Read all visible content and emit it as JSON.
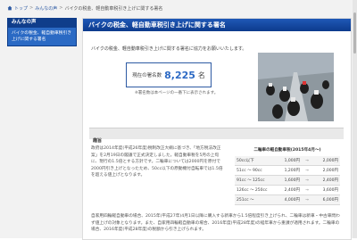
{
  "breadcrumb": {
    "items": [
      "トップ",
      "みんなの声",
      "バイクの税金、軽自動車税引き上げに関する署名"
    ]
  },
  "sidebar": {
    "heading": "みんなの声",
    "item": "バイクの税金、軽自動車税引き上げに関する署名"
  },
  "main": {
    "title": "バイクの税金、軽自動車税引き上げに関する署名",
    "lead": "バイクの税金、軽自動車税引き上げに関する署名に協力をお願いいたします。",
    "count": {
      "label": "現在の署名数",
      "value": "8,225",
      "unit": "名"
    },
    "count_note": "※署名数は本ページの一番下に表示されます。",
    "section_title": "趣旨",
    "para1": "政府は2014年度(平成26年度)税制改正大綱に基づき、「地方税法改正案」を2月19日の閣議で正式決定しました。軽自動車税を5月の上旬に、現行の1.5倍とする方針です。二輪車については2000円を原付で2000円引き上げとなったため、50cc以下の原動機付自転車では1.5倍を超える値上げとなります。",
    "para2": "自家用四輪軽自動車の場合、2015年(平成27年)4月1日以降に購入する新車から1.5倍程度引き上げられ、二輪車は新車・中古車問わず値上げの対象となります。また、自家用四輪軽自動車の場合、2016年度(平成28年度)の経年車から重課が適用されます。二輪車の場合、2016年度(平成28年度)の税額から引き上げられます。"
  },
  "rates": {
    "title": "二輪車の軽自動車税(2015年4月〜)",
    "rows": [
      {
        "class": "50cc以下",
        "old": "1,000円",
        "arrow": "→",
        "new": "2,000円"
      },
      {
        "class": "51cc 〜 90cc",
        "old": "1,200円",
        "arrow": "→",
        "new": "2,000円"
      },
      {
        "class": "91cc 〜 125cc",
        "old": "1,600円",
        "arrow": "→",
        "new": "2,400円"
      },
      {
        "class": "126cc 〜 250cc",
        "old": "2,400円",
        "arrow": "→",
        "new": "3,600円"
      },
      {
        "class": "251cc 〜",
        "old": "4,000円",
        "arrow": "→",
        "new": "6,000円"
      }
    ]
  },
  "colors": {
    "title_bar": "#1f58b6",
    "sidebar_head": "#0f3d8a",
    "sidebar_item": "#2b6ac4",
    "count_value": "#2d6ac4"
  },
  "icons": {
    "home": "home-icon",
    "photo": "motorcycle-photo"
  }
}
